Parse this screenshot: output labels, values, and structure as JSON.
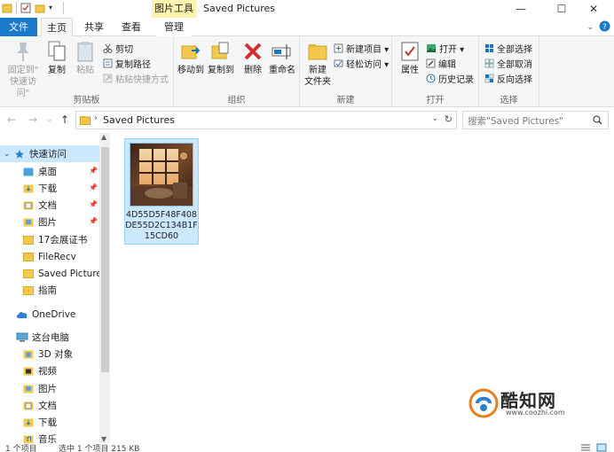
{
  "titlebar": {
    "context_group": "图片工具",
    "title": "Saved Pictures",
    "minimize": "—",
    "maximize": "☐",
    "close": "✕"
  },
  "tabs": {
    "file": "文件",
    "home": "主页",
    "share": "共享",
    "view": "查看",
    "manage": "管理"
  },
  "ribbon": {
    "clipboard": {
      "label": "剪贴板",
      "pin_quick_access_1": "固定到\"",
      "pin_quick_access_2": "快速访问\"",
      "copy": "复制",
      "paste": "粘贴",
      "cut": "剪切",
      "copy_path": "复制路径",
      "paste_shortcut": "粘贴快捷方式"
    },
    "organize": {
      "label": "组织",
      "move_to": "移动到",
      "copy_to": "复制到",
      "delete": "删除",
      "rename": "重命名"
    },
    "new": {
      "label": "新建",
      "new_folder_1": "新建",
      "new_folder_2": "文件夹",
      "new_item": "新建项目 ▾",
      "easy_access": "轻松访问 ▾"
    },
    "open": {
      "label": "打开",
      "properties": "属性",
      "open": "打开 ▾",
      "edit": "编辑",
      "history": "历史记录"
    },
    "select": {
      "label": "选择",
      "select_all": "全部选择",
      "select_none": "全部取消",
      "invert": "反向选择"
    }
  },
  "address": {
    "path": "Saved Pictures",
    "search_placeholder": "搜索\"Saved Pictures\""
  },
  "navpane": {
    "quick_access": "快速访问",
    "desktop": "桌面",
    "downloads": "下载",
    "documents": "文档",
    "pictures": "图片",
    "folder_17": "17会展证书",
    "filerecv": "FileRecv",
    "saved_pictures": "Saved Pictures",
    "guide": "指南",
    "onedrive": "OneDrive",
    "this_pc": "这台电脑",
    "objects_3d": "3D 对象",
    "videos": "视频",
    "pc_pictures": "图片",
    "pc_documents": "文档",
    "pc_downloads": "下载",
    "music": "音乐"
  },
  "files": [
    {
      "name": "4D55D5F48F408DE55D2C134B1F15CD60"
    }
  ],
  "status": {
    "count": "1 个项目",
    "selected": "选中 1 个项目  215 KB"
  },
  "watermark": {
    "brand": "酷知网",
    "url": "www.coozhi.com"
  },
  "colors": {
    "file_tab": "#1979ca",
    "context_tab": "#fff3b0",
    "selection": "#cce8ff",
    "ribbon_bg": "#f5f6f7"
  }
}
